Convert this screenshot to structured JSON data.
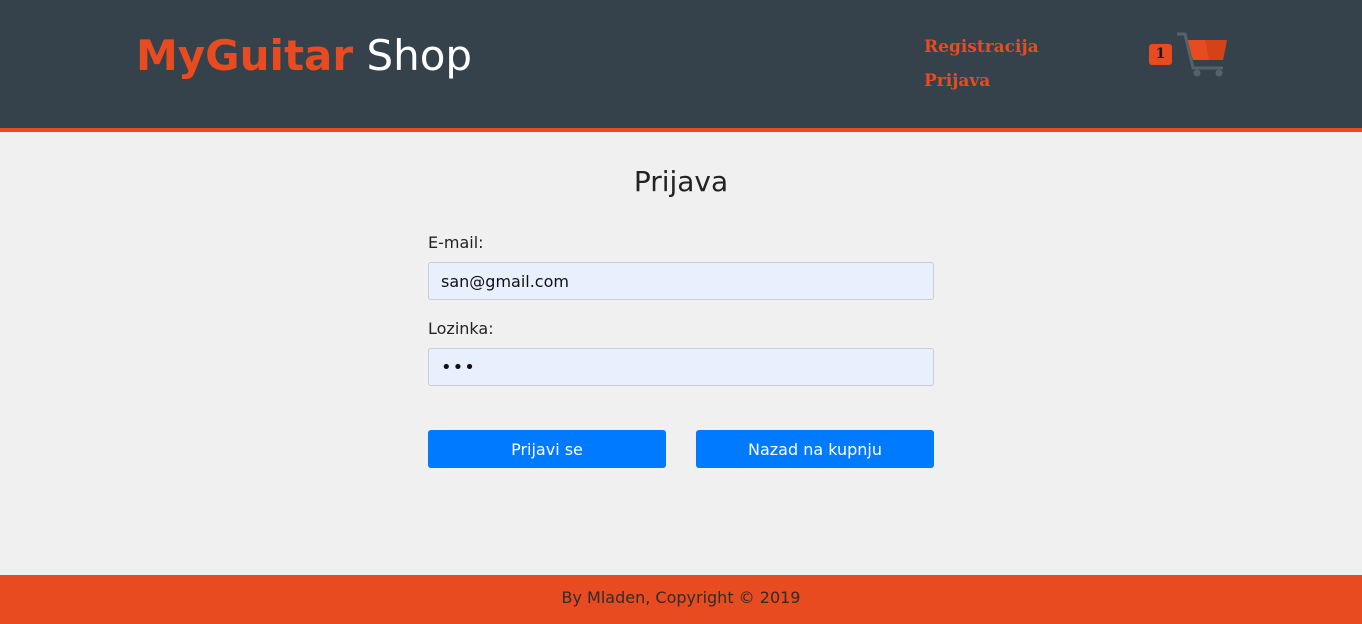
{
  "header": {
    "logo_brand": "MyGuitar",
    "logo_shop": "Shop",
    "nav": {
      "register": "Registracija",
      "login": "Prijava"
    },
    "cart_count": "1",
    "cart_icon": "shopping-cart-icon"
  },
  "main": {
    "title": "Prijava",
    "email_label": "E-mail:",
    "email_value": "san@gmail.com",
    "password_label": "Lozinka:",
    "password_value": "abc",
    "login_button": "Prijavi se",
    "back_button": "Nazad na kupnju"
  },
  "footer": {
    "text": "By Mladen, Copyright © 2019"
  },
  "colors": {
    "header_bg": "#36424b",
    "accent": "#e84b1f",
    "button": "#007bff",
    "page_bg": "#f0f0f0",
    "input_bg": "#e8f0fe"
  }
}
